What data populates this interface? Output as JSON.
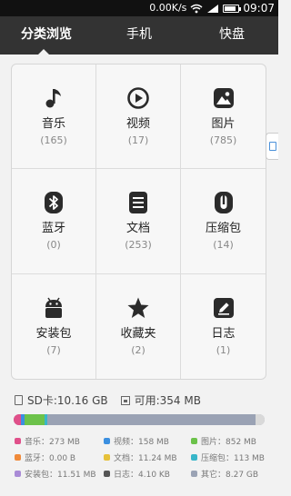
{
  "status_bar": {
    "speed": "0.00K/s",
    "time": "09:07"
  },
  "tabs": [
    {
      "label": "分类浏览",
      "active": true
    },
    {
      "label": "手机",
      "active": false
    },
    {
      "label": "快盘",
      "active": false
    }
  ],
  "categories": [
    {
      "label": "音乐",
      "count": "(165)",
      "icon": "music-icon"
    },
    {
      "label": "视频",
      "count": "(17)",
      "icon": "video-icon"
    },
    {
      "label": "图片",
      "count": "(785)",
      "icon": "image-icon"
    },
    {
      "label": "蓝牙",
      "count": "(0)",
      "icon": "bluetooth-icon"
    },
    {
      "label": "文档",
      "count": "(253)",
      "icon": "document-icon"
    },
    {
      "label": "压缩包",
      "count": "(14)",
      "icon": "archive-icon"
    },
    {
      "label": "安装包",
      "count": "(7)",
      "icon": "android-icon"
    },
    {
      "label": "收藏夹",
      "count": "(2)",
      "icon": "star-icon"
    },
    {
      "label": "日志",
      "count": "(1)",
      "icon": "log-icon"
    }
  ],
  "storage": {
    "sd_label": "SD卡:10.16 GB",
    "free_label": "可用:354 MB",
    "legend": [
      {
        "label": "音乐：273 MB",
        "color": "#e0508a"
      },
      {
        "label": "视频：158 MB",
        "color": "#3b8fe0"
      },
      {
        "label": "图片：852 MB",
        "color": "#6cc24a"
      },
      {
        "label": "蓝牙：0.00 B",
        "color": "#f08a3a"
      },
      {
        "label": "文档：11.24 MB",
        "color": "#e6c13a"
      },
      {
        "label": "压缩包：113 MB",
        "color": "#38b6c9"
      },
      {
        "label": "安装包：11.51 MB",
        "color": "#a98bd6"
      },
      {
        "label": "日志：4.10 KB",
        "color": "#555555"
      },
      {
        "label": "其它：8.27 GB",
        "color": "#9aa2b4"
      }
    ]
  }
}
